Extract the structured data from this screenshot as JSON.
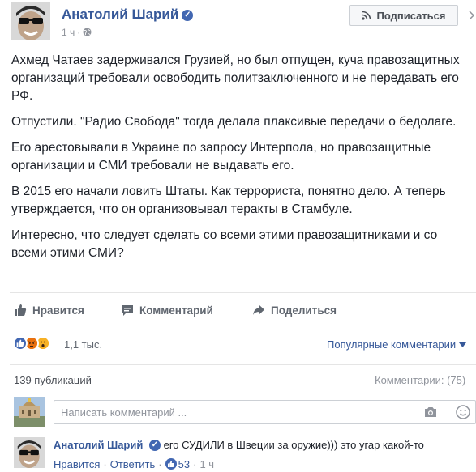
{
  "post": {
    "author": "Анатолий Шарий",
    "time": "1 ч",
    "subscribe_label": "Подписаться",
    "paragraphs": [
      "Ахмед Чатаев задерживался Грузией, но был отпущен, куча правозащитных организаций требовали освободить политзаключенного и не передавать его РФ.",
      "Отпустили. \"Радио Свобода\" тогда делала плаксивые передачи о бедолаге.",
      "Его арестовывали в Украине по запросу Интерпола, но правозащитные организации и СМИ требовали не выдавать его.",
      "В 2015 его начали ловить Штаты. Как террориста, понятно дело. А теперь утверждается, что он организовывал теракты в Стамбуле.",
      "Интересно, что следует сделать со всеми этими правозащитниками и со всеми этими СМИ?"
    ]
  },
  "actions": {
    "like": "Нравится",
    "comment": "Комментарий",
    "share": "Поделиться"
  },
  "reactions": {
    "count": "1,1 тыс.",
    "sort_label": "Популярные комментарии",
    "icons": [
      "like-reaction-icon",
      "angry-reaction-icon",
      "wow-reaction-icon"
    ]
  },
  "stats": {
    "publications": "139 публикаций",
    "comments": "Комментарии: (75)"
  },
  "composer": {
    "placeholder": "Написать комментарий ..."
  },
  "comment": {
    "author": "Анатолий Шарий",
    "text": "его СУДИЛИ в Швеции за оружие))) это угар какой-то",
    "like": "Нравится",
    "reply": "Ответить",
    "likes": "53",
    "time": "1 ч"
  },
  "colors": {
    "link": "#365899",
    "text": "#1d2129",
    "muted": "#90949c",
    "brand": "#4267b2"
  }
}
